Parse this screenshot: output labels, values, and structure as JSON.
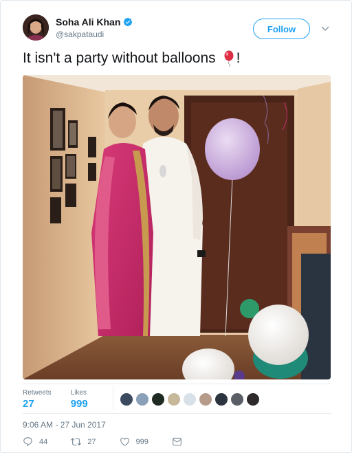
{
  "user": {
    "name": "Soha Ali Khan",
    "handle": "@sakpataudi"
  },
  "follow_label": "Follow",
  "tweet": {
    "text": "It isn't a party without balloons",
    "text_end": "!",
    "emoji": "balloon-icon"
  },
  "stats": {
    "retweets_label": "Retweets",
    "retweets": "27",
    "likes_label": "Likes",
    "likes": "999"
  },
  "timestamp": "9:06 AM - 27 Jun 2017",
  "actions": {
    "replies": "44",
    "retweets": "27",
    "likes": "999"
  },
  "colors": {
    "accent": "#1da1f2",
    "secondary_text": "#657786",
    "primary_text": "#14171a"
  },
  "liker_avatars": [
    "#3b4a5e",
    "#8aa0b8",
    "#1f2a22",
    "#c8b89a",
    "#d9e1e8",
    "#b79b8a",
    "#2c3440",
    "#5a5f66",
    "#2e2a2c"
  ]
}
